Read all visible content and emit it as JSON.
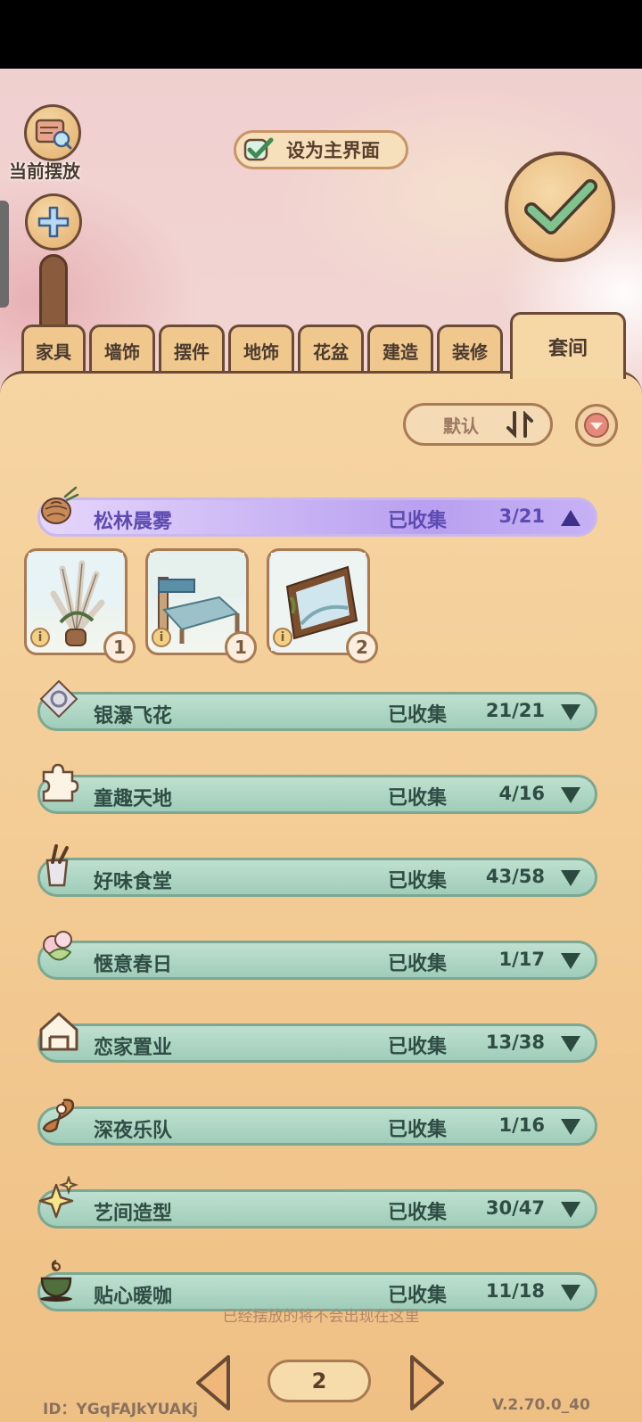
{
  "toolbar": {
    "placed_label": "当前摆放",
    "set_home_label": "设为主界面"
  },
  "tabs": [
    "家具",
    "墙饰",
    "摆件",
    "地饰",
    "花盆",
    "建造",
    "装修",
    "套间"
  ],
  "active_tab": "套间",
  "sort": {
    "label": "默认"
  },
  "expanded_set": {
    "name": "松林晨雾",
    "collected_label": "已收集",
    "count": "3/21",
    "items": [
      {
        "icon": "pampas-grass-planter",
        "qty": "1"
      },
      {
        "icon": "rustic-bed",
        "qty": "1"
      },
      {
        "icon": "framed-painting",
        "qty": "2"
      }
    ]
  },
  "sets": [
    {
      "name": "银瀑飞花",
      "collected_label": "已收集",
      "count": "21/21",
      "icon": "gear-ornament-icon"
    },
    {
      "name": "童趣天地",
      "collected_label": "已收集",
      "count": "4/16",
      "icon": "puzzle-icon"
    },
    {
      "name": "好味食堂",
      "collected_label": "已收集",
      "count": "43/58",
      "icon": "utensil-cup-icon"
    },
    {
      "name": "惬意春日",
      "collected_label": "已收集",
      "count": "1/17",
      "icon": "flower-icon"
    },
    {
      "name": "恋家置业",
      "collected_label": "已收集",
      "count": "13/38",
      "icon": "house-icon"
    },
    {
      "name": "深夜乐队",
      "collected_label": "已收集",
      "count": "1/16",
      "icon": "music-note-icon"
    },
    {
      "name": "艺间造型",
      "collected_label": "已收集",
      "count": "30/47",
      "icon": "sparkle-icon"
    },
    {
      "name": "贴心暖咖",
      "collected_label": "已收集",
      "count": "11/18",
      "icon": "coffee-cup-icon"
    }
  ],
  "footer": {
    "hint": "已经摆放的将不会出现在这里",
    "page": "2",
    "id_text": "ID：YGqFAJkYUAKj",
    "version": "V.2.70.0_40"
  },
  "colors": {
    "panel": "#f6d5a3",
    "row": "#a8d3bf",
    "expanded_row": "#c3adf4",
    "border": "#6b4b36"
  }
}
